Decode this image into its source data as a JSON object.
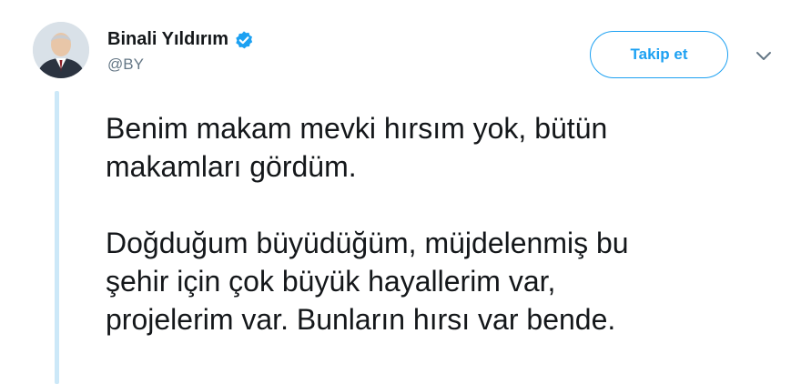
{
  "tweet": {
    "author": {
      "display_name": "Binali Yıldırım",
      "handle": "@BY",
      "verified": true,
      "avatar_icon": "profile-photo"
    },
    "follow_button_label": "Takip et",
    "menu_icon": "chevron-down-icon",
    "paragraphs": [
      "Benim makam mevki hırsım yok, bütün\nmakamları gördüm.",
      "Doğduğum büyüdüğüm, müjdelenmiş bu\nşehir için çok büyük hayallerim var,\nprojelerim var. Bunların hırsı var bende."
    ]
  },
  "colors": {
    "brand_blue": "#1da1f2",
    "thread_line": "#cce8f8",
    "text_primary": "#14171a",
    "text_secondary": "#657786"
  }
}
